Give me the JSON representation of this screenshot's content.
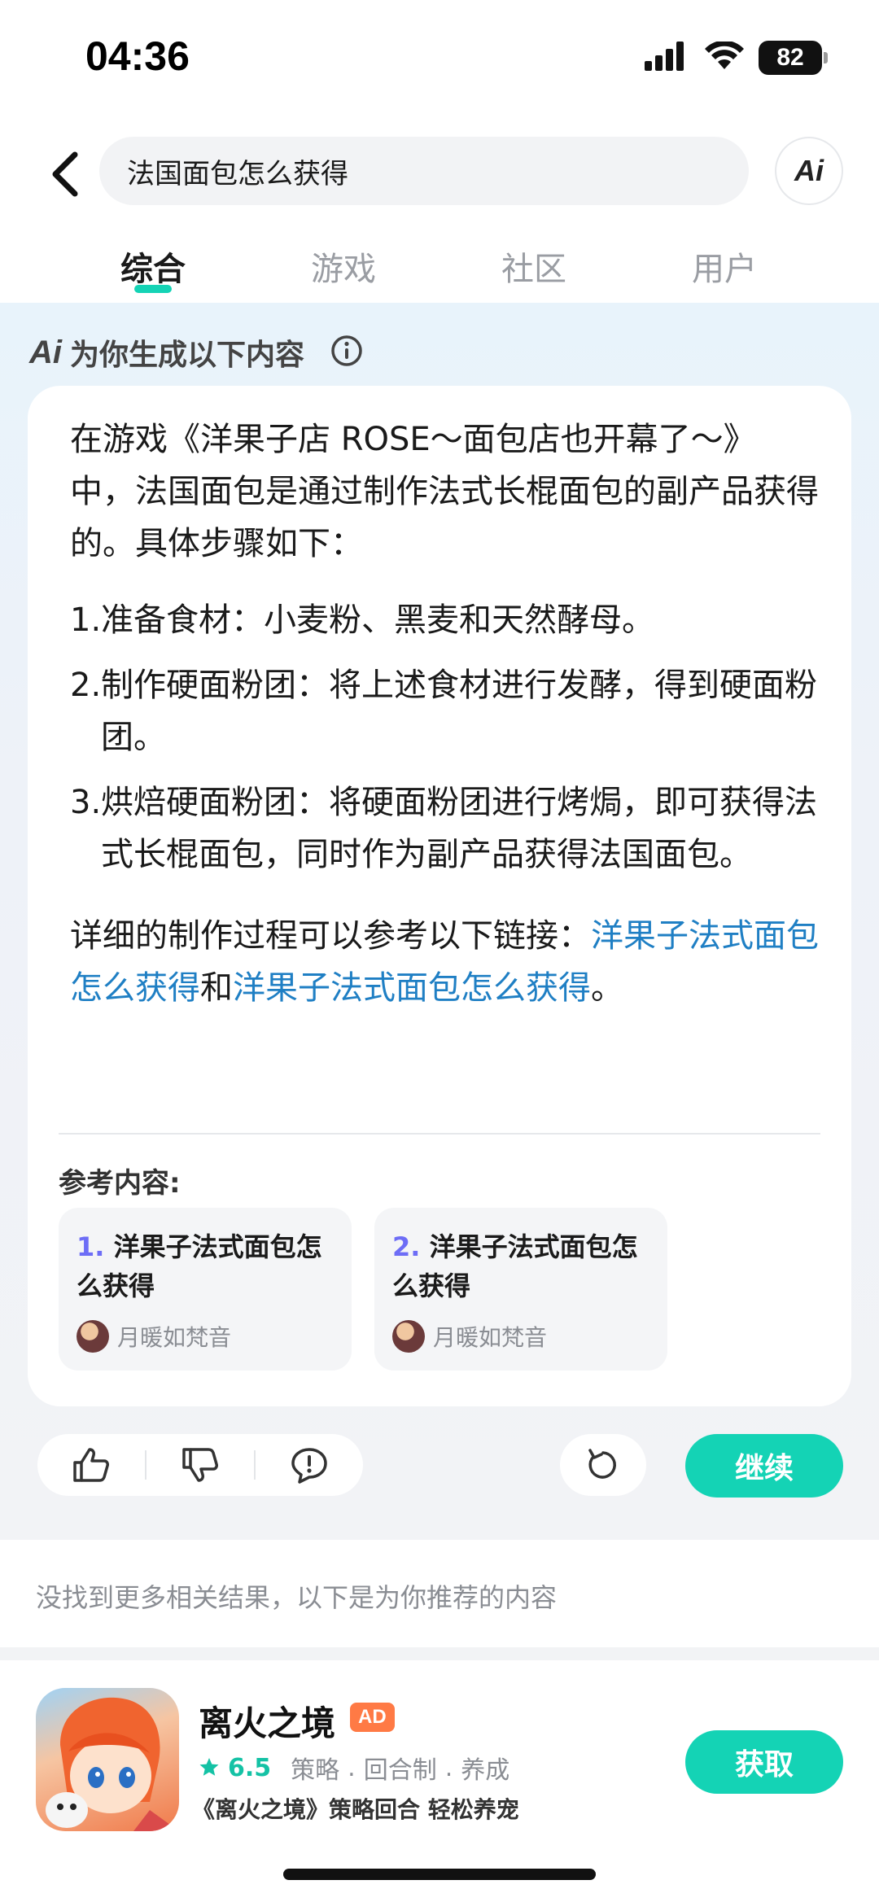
{
  "status_bar": {
    "time": "04:36",
    "battery": "82"
  },
  "search": {
    "query": "法国面包怎么获得",
    "ai_label": "Ai"
  },
  "tabs": [
    {
      "label": "综合"
    },
    {
      "label": "游戏"
    },
    {
      "label": "社区"
    },
    {
      "label": "用户"
    }
  ],
  "ai_section": {
    "logo": "Ai",
    "header": "为你生成以下内容",
    "intro": "在游戏《洋果子店 ROSE～面包店也开幕了～》中，法国面包是通过制作法式长棍面包的副产品获得的。具体步骤如下：",
    "steps": [
      {
        "num": "1.",
        "text": "准备食材：小麦粉、黑麦和天然酵母。"
      },
      {
        "num": "2.",
        "text": "制作硬面粉团：将上述食材进行发酵，得到硬面粉团。"
      },
      {
        "num": "3.",
        "text": "烘焙硬面粉团：将硬面粉团进行烤焗，即可获得法式长棍面包，同时作为副产品获得法国面包。"
      }
    ],
    "outro_prefix": "详细的制作过程可以参考以下链接：",
    "link1": "洋果子法式面包怎么获得",
    "outro_and": "和",
    "link2": "洋果子法式面包怎么获得",
    "outro_end": "。",
    "ref_title": "参考内容:",
    "references": [
      {
        "num": "1.",
        "title": "洋果子法式面包怎么获得",
        "author": "月暖如梵音"
      },
      {
        "num": "2.",
        "title": "洋果子法式面包怎么获得",
        "author": "月暖如梵音"
      }
    ],
    "continue_label": "继续"
  },
  "recommend": {
    "text": "没找到更多相关结果，以下是为你推荐的内容"
  },
  "ad": {
    "name": "离火之境",
    "badge": "AD",
    "rating": "6.5",
    "tags": [
      "策略",
      "回合制",
      "养成"
    ],
    "tag_sep": ".",
    "description": "《离火之境》策略回合 轻松养宠",
    "button": "获取"
  },
  "colors": {
    "accent": "#14d3b5",
    "link": "#1f7fc4",
    "ref_num": "#6d6df6",
    "ad_badge": "#ff7a45"
  }
}
